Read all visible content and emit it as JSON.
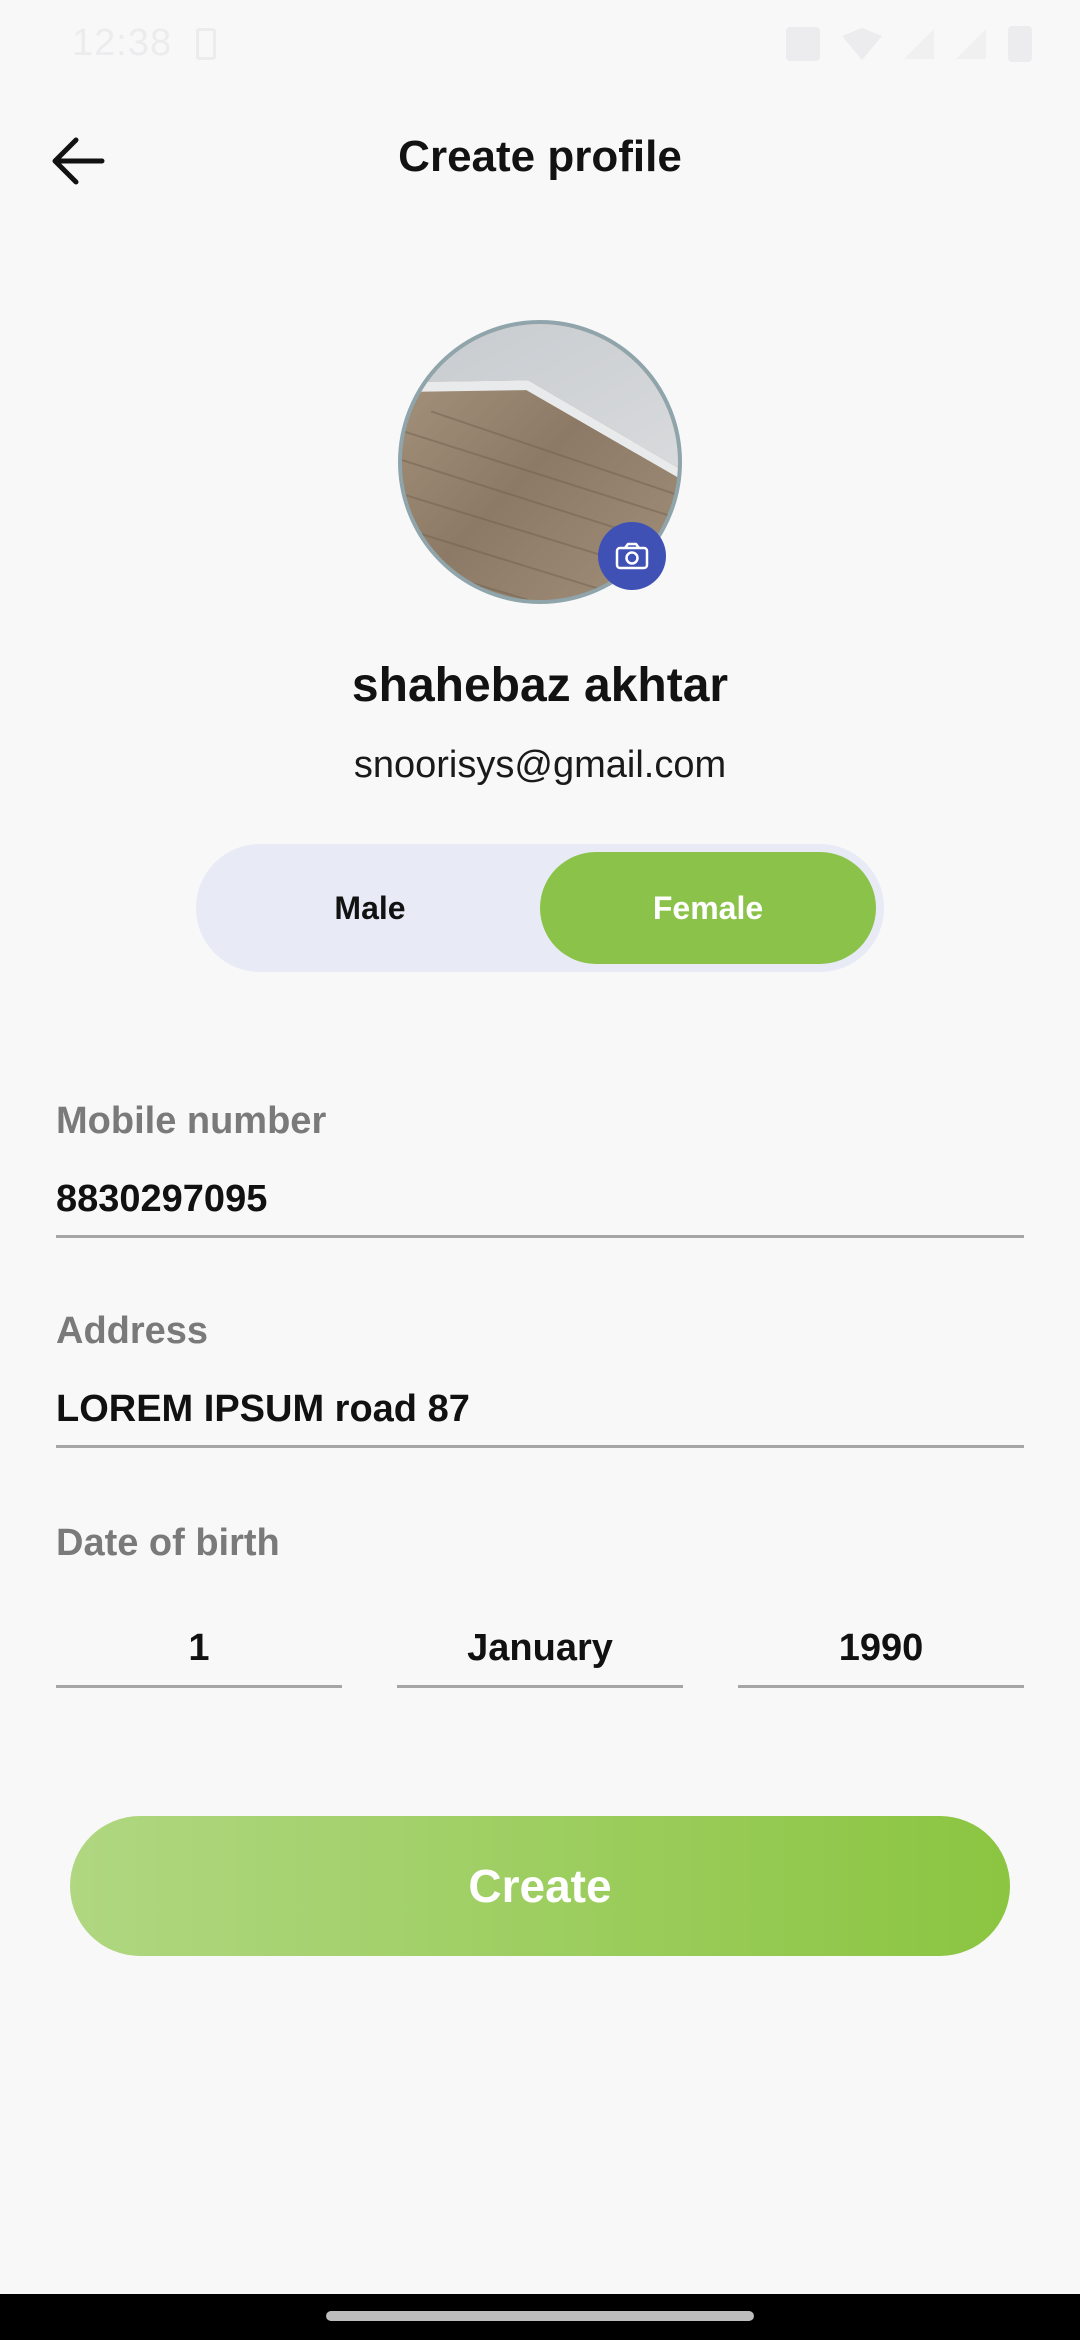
{
  "status_bar": {
    "time": "12:38",
    "icons": [
      "sim-card-icon",
      "nfc-icon",
      "wifi-icon",
      "signal-icon",
      "signal-icon",
      "battery-icon"
    ]
  },
  "header": {
    "back_icon": "arrow-left-icon",
    "title": "Create profile"
  },
  "profile": {
    "avatar": "profile-photo",
    "camera_icon": "camera-icon",
    "name": "shahebaz akhtar",
    "email": "snoorisys@gmail.com"
  },
  "gender": {
    "options": [
      "Male",
      "Female"
    ],
    "selected": "Female"
  },
  "form": {
    "mobile": {
      "label": "Mobile number",
      "value": "8830297095"
    },
    "address": {
      "label": "Address",
      "value": "LOREM IPSUM road 87"
    },
    "dob": {
      "label": "Date of birth",
      "day": "1",
      "month": "January",
      "year": "1990"
    }
  },
  "actions": {
    "create_label": "Create"
  },
  "colors": {
    "accent_green": "#8bc34a",
    "toggle_track": "#e8eaf6",
    "camera_badge": "#3f51b5",
    "background": "#f8f8f9"
  }
}
